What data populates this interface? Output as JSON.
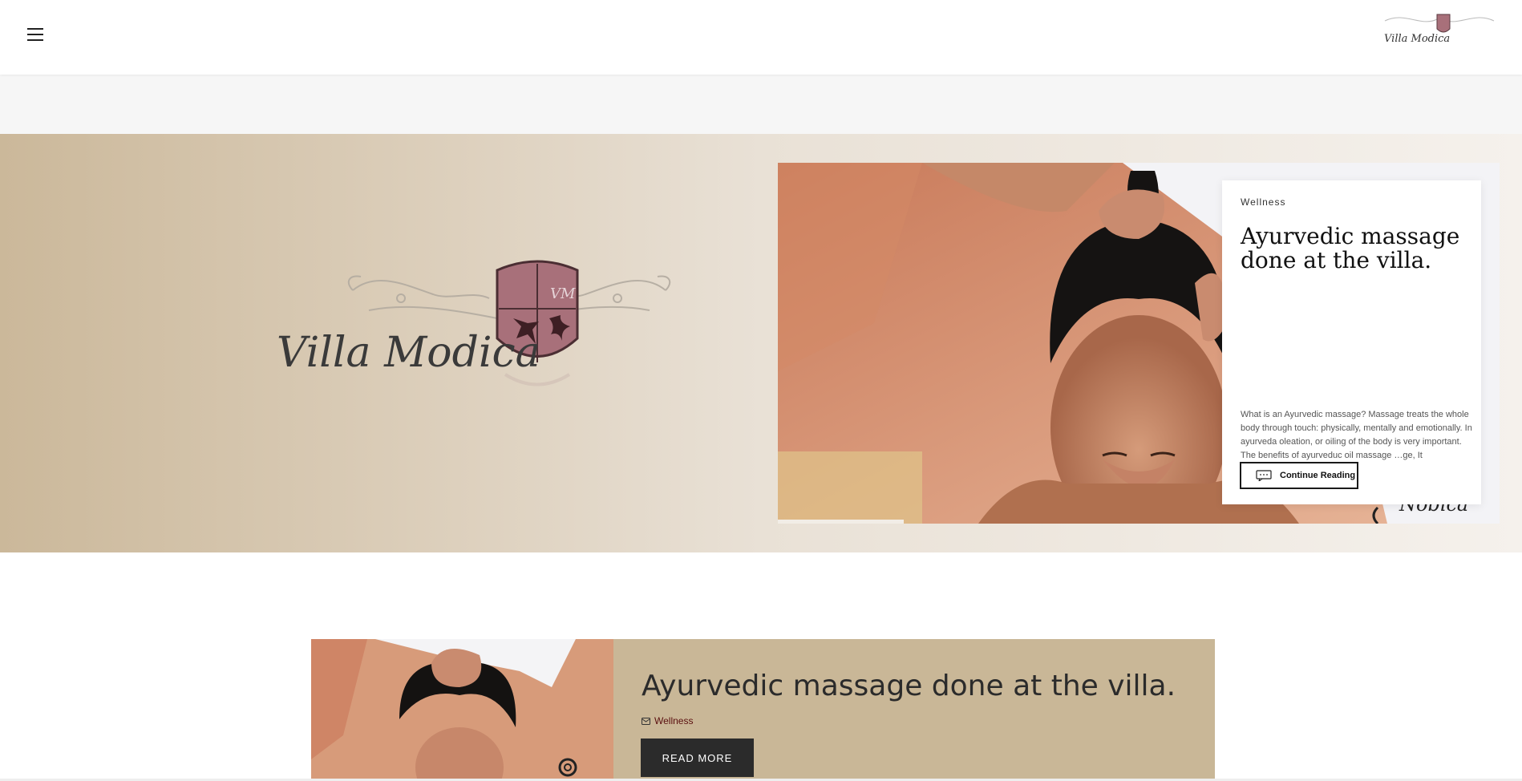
{
  "header": {
    "menu_icon": "hamburger-menu-icon",
    "logo_text": "Villa Modica"
  },
  "hero": {
    "logo_text": "Villa Modica",
    "crest_initials": "VM"
  },
  "slide": {
    "category": "Wellness",
    "title": "Ayurvedic massage done at the villa.",
    "excerpt": "What is an Ayurvedic massage? Massage treats the whole body through touch: physically, mentally and emotionally.  In ayurveda oleation, or oiling of the body is very important. The benefits of ayurveduc oil massage …ge, It",
    "continue_label": "Continue Reading",
    "continue_icon": "comment-bubble-icon"
  },
  "post": {
    "title": "Ayurvedic massage done at the villa.",
    "category": "Wellness",
    "category_icon": "envelope-icon",
    "read_more_label": "READ MORE"
  },
  "colors": {
    "hero_tan": "#cbb89a",
    "post_bg": "#c9b797",
    "crest": "#a8707a",
    "category_link": "#5a0f0f",
    "button_dark": "#2b2b2b"
  }
}
